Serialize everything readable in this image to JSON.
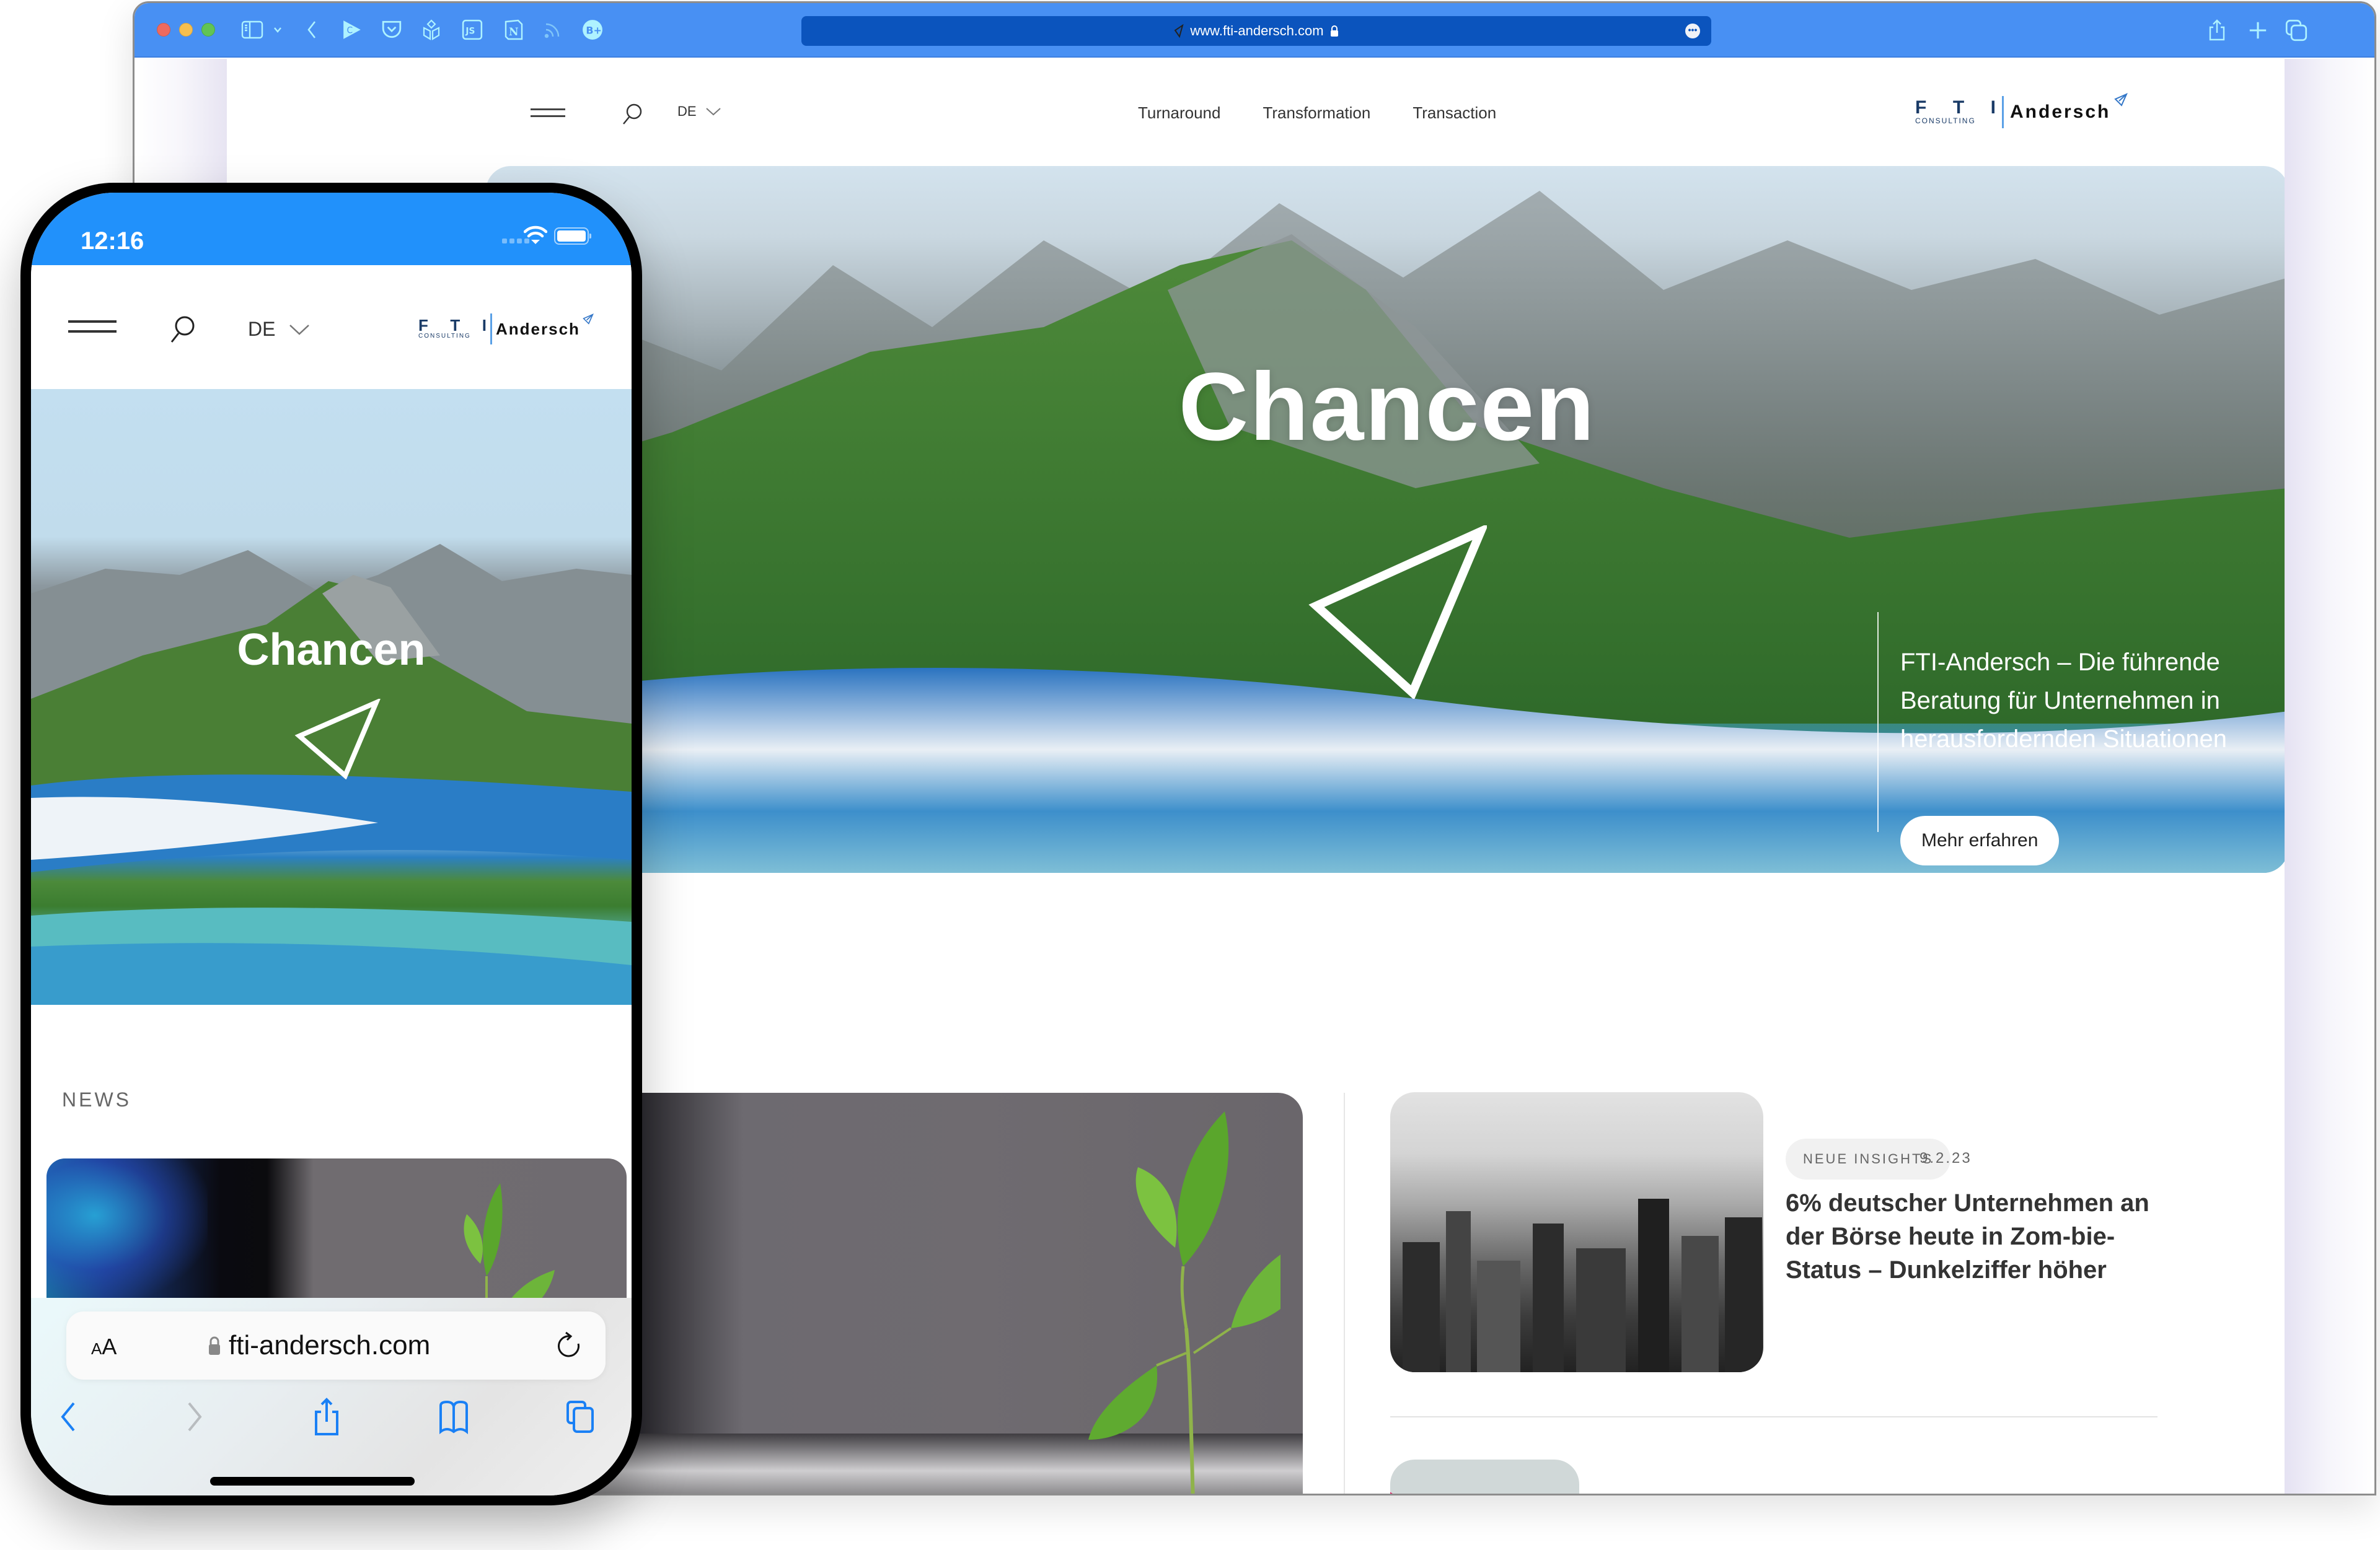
{
  "desktop": {
    "window_controls": [
      "close",
      "minimize",
      "zoom"
    ],
    "toolbar_icons": [
      "sidebar-icon",
      "chevron-down-icon",
      "back-icon",
      "play-c-extension-icon",
      "pocket-icon",
      "cube-extension-icon",
      "js-extension-icon",
      "notion-icon",
      "rss-icon",
      "bplus-extension-icon"
    ],
    "address_bar": {
      "url": "www.fti-andersch.com",
      "secure": true
    },
    "right_toolbar_icons": [
      "share-icon",
      "new-tab-icon",
      "tabs-overview-icon"
    ],
    "site": {
      "language": "DE",
      "nav": [
        "Turnaround",
        "Transformation",
        "Transaction"
      ],
      "logo": {
        "fti_letters": [
          "F",
          "T",
          "I"
        ],
        "fti_subtitle": "CONSULTING",
        "brand": "Andersch"
      },
      "hero": {
        "title": "Chancen",
        "text": "FTI-Andersch – Die führende Beratung für Unternehmen in herausfordernden Situationen",
        "button": "Mehr erfahren"
      },
      "news": {
        "items": [
          {
            "badge": "NEUE INSIGHTS",
            "date": "9.2.23",
            "title": "6% deutscher Unternehmen an der Börse heute in Zom-bie-Status – Dunkelziffer höher"
          }
        ]
      }
    }
  },
  "phone": {
    "status_bar": {
      "time": "12:16",
      "wifi": true,
      "battery_full": true
    },
    "site": {
      "language": "DE",
      "logo": {
        "fti_letters": [
          "F",
          "T",
          "I"
        ],
        "fti_subtitle": "CONSULTING",
        "brand": "Andersch"
      },
      "hero_title": "Chancen",
      "news_label": "NEWS"
    },
    "safari": {
      "text_size_label": "AA",
      "url": "fti-andersch.com",
      "toolbar": [
        "back",
        "forward",
        "share",
        "bookmarks",
        "tabs"
      ]
    }
  },
  "colors": {
    "mac_titlebar": "#4890f3",
    "mac_urlbar": "#0b54bd",
    "ios_statusbar": "#2191fb",
    "ios_accent": "#1a80f5",
    "brand_navy": "#1a3b67",
    "brand_blue": "#3477c8"
  }
}
